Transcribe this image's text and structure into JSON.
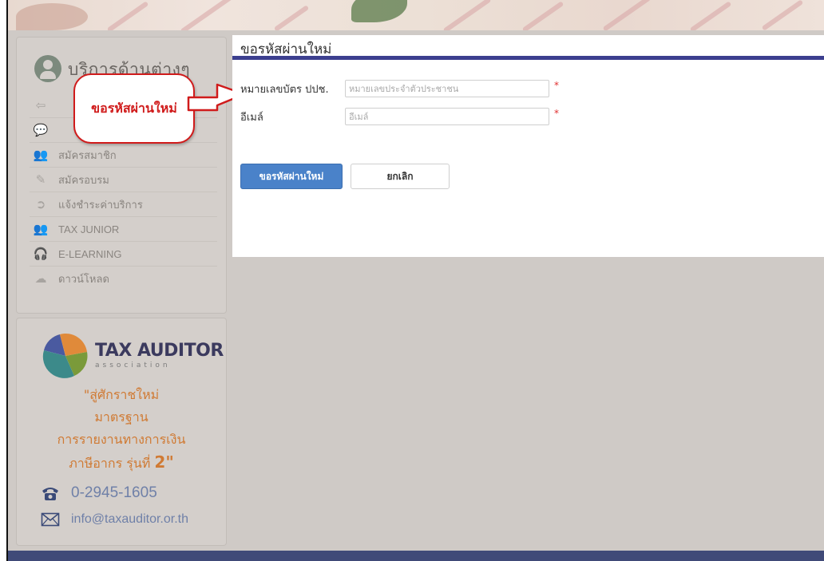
{
  "sidebar": {
    "title": "บริการด้านต่างๆ",
    "items": [
      {
        "label": "",
        "icon": "login-icon"
      },
      {
        "label": "",
        "icon": "chat-icon"
      },
      {
        "label": "สมัครสมาชิก",
        "icon": "members-icon"
      },
      {
        "label": "สมัครอบรม",
        "icon": "training-icon"
      },
      {
        "label": "แจ้งชำระค่าบริการ",
        "icon": "payment-arrow-icon"
      },
      {
        "label": "TAX JUNIOR",
        "icon": "group-icon"
      },
      {
        "label": "E-LEARNING",
        "icon": "headset-icon"
      },
      {
        "label": "ดาวน์โหลด",
        "icon": "download-icon"
      }
    ]
  },
  "callout": {
    "text": "ขอรหัสผ่านใหม่",
    "color": "#d01b1b"
  },
  "promo": {
    "logo_text": "TAX AUDITOR",
    "logo_sub": "association",
    "line1": "\"สู่ศักราชใหม่",
    "line2": "มาตรฐาน",
    "line3": "การรายงานทางการเงิน",
    "line4_prefix": "ภาษีอากร รุ่นที่ ",
    "line4_number": "2",
    "line4_suffix": "\"",
    "phone": "0-2945-1605",
    "email": "info@taxauditor.or.th"
  },
  "form": {
    "title": "ขอรหัสผ่านใหม่",
    "id_label": "หมายเลขบัตร ปปช.",
    "id_placeholder": "หมายเลขประจำตัวประชาชน",
    "id_value": "",
    "email_label": "อีเมล์",
    "email_placeholder": "อีเมล์",
    "email_value": "",
    "required_mark": "*",
    "submit_label": "ขอรหัสผ่านใหม่",
    "cancel_label": "ยกเลิก"
  },
  "colors": {
    "accent_bar": "#3c3f8f",
    "submit_bg": "#4a82c9",
    "promo_text": "#d07a33",
    "footer": "#404a78"
  }
}
